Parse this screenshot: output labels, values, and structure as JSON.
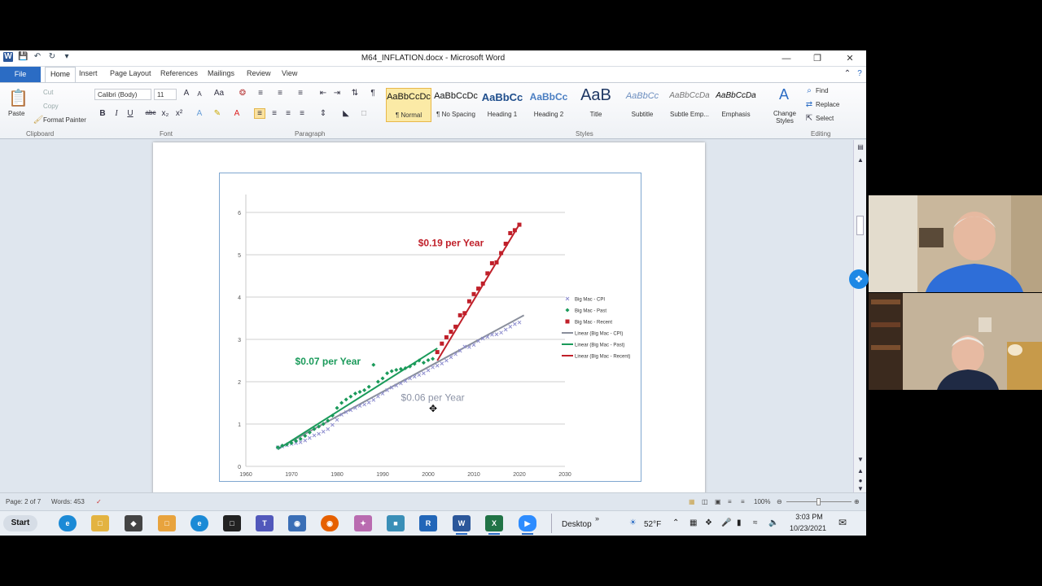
{
  "window": {
    "title": "M64_INFLATION.docx - Microsoft Word"
  },
  "ribbon": {
    "tabs": [
      "File",
      "Home",
      "Insert",
      "Page Layout",
      "References",
      "Mailings",
      "Review",
      "View"
    ],
    "clipboard": {
      "paste": "Paste",
      "cut": "Cut",
      "copy": "Copy",
      "format_painter": "Format Painter",
      "group": "Clipboard"
    },
    "font": {
      "name": "Calibri (Body)",
      "size": "11",
      "group": "Font"
    },
    "paragraph": {
      "group": "Paragraph"
    },
    "styles": {
      "items": [
        {
          "sample": "AaBbCcDc",
          "name": "¶ Normal"
        },
        {
          "sample": "AaBbCcDc",
          "name": "¶ No Spacing"
        },
        {
          "sample": "AaBbCc",
          "name": "Heading 1"
        },
        {
          "sample": "AaBbCc",
          "name": "Heading 2"
        },
        {
          "sample": "AaB",
          "name": "Title"
        },
        {
          "sample": "AaBbCc",
          "name": "Subtitle"
        },
        {
          "sample": "AaBbCcDa",
          "name": "Subtle Emp..."
        },
        {
          "sample": "AaBbCcDa",
          "name": "Emphasis"
        }
      ],
      "change_styles": "Change Styles",
      "group": "Styles"
    },
    "editing": {
      "find": "Find",
      "replace": "Replace",
      "select": "Select",
      "group": "Editing"
    }
  },
  "statusbar": {
    "page": "Page: 2 of 7",
    "words": "Words: 453",
    "zoom": "100%"
  },
  "taskbar": {
    "start": "Start",
    "desktop": "Desktop",
    "temperature": "52°F",
    "time": "3:03 PM",
    "date": "10/23/2021"
  },
  "chart_data": {
    "type": "scatter",
    "xlim": [
      1960,
      2030
    ],
    "ylim": [
      0,
      6
    ],
    "xticks": [
      1960,
      1970,
      1980,
      1990,
      2000,
      2010,
      2020,
      2030
    ],
    "yticks": [
      0,
      1,
      2,
      3,
      4,
      5,
      6
    ],
    "annotations": [
      {
        "text": "$0.19 per Year",
        "color": "#c0202a",
        "x": 2005,
        "y": 5.2
      },
      {
        "text": "$0.07 per Year",
        "color": "#1a9a5a",
        "x": 1978,
        "y": 2.4
      },
      {
        "text": "$0.06 per Year",
        "color": "#8c93a6",
        "x": 2001,
        "y": 1.55
      }
    ],
    "series": [
      {
        "name": "Big Mac - CPI",
        "marker": "x",
        "color": "#8e8ecf",
        "x": [
          1967,
          1968,
          1969,
          1970,
          1971,
          1972,
          1973,
          1974,
          1975,
          1976,
          1977,
          1978,
          1979,
          1980,
          1981,
          1982,
          1983,
          1984,
          1985,
          1986,
          1987,
          1988,
          1989,
          1990,
          1991,
          1992,
          1993,
          1994,
          1995,
          1996,
          1997,
          1998,
          1999,
          2000,
          2001,
          2002,
          2003,
          2004,
          2005,
          2006,
          2007,
          2008,
          2009,
          2010,
          2011,
          2012,
          2013,
          2014,
          2015,
          2016,
          2017,
          2018,
          2019,
          2020
        ],
        "y": [
          0.45,
          0.47,
          0.5,
          0.53,
          0.55,
          0.57,
          0.61,
          0.67,
          0.73,
          0.77,
          0.82,
          0.88,
          0.98,
          1.1,
          1.22,
          1.28,
          1.33,
          1.38,
          1.43,
          1.46,
          1.51,
          1.57,
          1.65,
          1.72,
          1.8,
          1.86,
          1.91,
          1.96,
          2.02,
          2.08,
          2.12,
          2.16,
          2.2,
          2.27,
          2.34,
          2.38,
          2.43,
          2.5,
          2.58,
          2.65,
          2.73,
          2.83,
          2.82,
          2.87,
          2.96,
          3.02,
          3.06,
          3.11,
          3.12,
          3.16,
          3.23,
          3.3,
          3.36,
          3.4
        ]
      },
      {
        "name": "Big Mac - Past",
        "marker": "diamond",
        "color": "#1a9a5a",
        "x": [
          1967,
          1968,
          1969,
          1970,
          1971,
          1972,
          1973,
          1974,
          1975,
          1976,
          1977,
          1978,
          1979,
          1980,
          1981,
          1982,
          1983,
          1984,
          1985,
          1986,
          1987,
          1988,
          1989,
          1990,
          1991,
          1992,
          1993,
          1994,
          1995,
          1996,
          1997,
          1998,
          1999,
          2000,
          2001
        ],
        "y": [
          0.45,
          0.49,
          0.52,
          0.55,
          0.6,
          0.65,
          0.72,
          0.8,
          0.88,
          0.94,
          1.0,
          1.08,
          1.2,
          1.38,
          1.5,
          1.58,
          1.65,
          1.72,
          1.76,
          1.8,
          1.88,
          2.4,
          2.0,
          2.08,
          2.2,
          2.25,
          2.28,
          2.3,
          2.32,
          2.36,
          2.42,
          2.5,
          2.45,
          2.51,
          2.54
        ]
      },
      {
        "name": "Big Mac - Recent",
        "marker": "square",
        "color": "#c0202a",
        "x": [
          2002,
          2003,
          2004,
          2005,
          2006,
          2007,
          2008,
          2009,
          2010,
          2011,
          2012,
          2013,
          2014,
          2015,
          2016,
          2017,
          2018,
          2019,
          2020
        ],
        "y": [
          2.7,
          2.9,
          3.05,
          3.18,
          3.3,
          3.57,
          3.62,
          3.9,
          4.07,
          4.2,
          4.32,
          4.56,
          4.8,
          4.82,
          5.04,
          5.26,
          5.51,
          5.58,
          5.71
        ]
      },
      {
        "name": "Linear (Big Mac - CPI)",
        "marker": "line",
        "color": "#8a8f9c",
        "x": [
          1967,
          2021
        ],
        "y": [
          0.42,
          3.57
        ]
      },
      {
        "name": "Linear (Big Mac - Past)",
        "marker": "line",
        "color": "#1a9a5a",
        "x": [
          1967,
          2002
        ],
        "y": [
          0.4,
          2.79
        ]
      },
      {
        "name": "Linear (Big Mac - Recent)",
        "marker": "line",
        "color": "#c0202a",
        "x": [
          2002,
          2020
        ],
        "y": [
          2.5,
          5.72
        ]
      }
    ]
  }
}
